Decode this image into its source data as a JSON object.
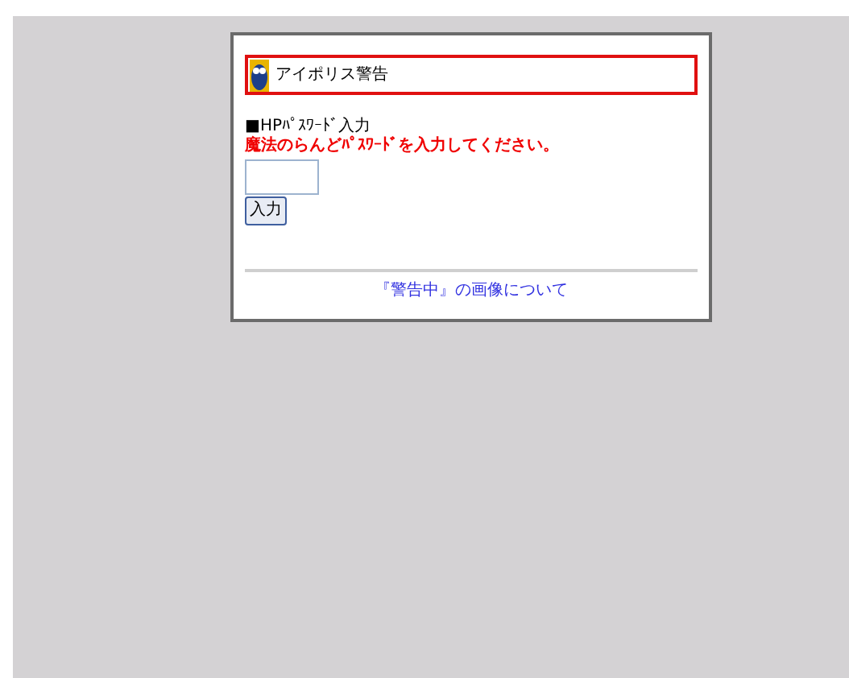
{
  "header": {
    "title": "アイポリス警告"
  },
  "password_section": {
    "heading": "■HPﾊﾟｽﾜｰﾄﾞ入力",
    "instruction": "魔法のらんどﾊﾟｽﾜｰﾄﾞを入力してください。",
    "submit_button": "入力"
  },
  "footer_link": "『警告中』の画像について"
}
